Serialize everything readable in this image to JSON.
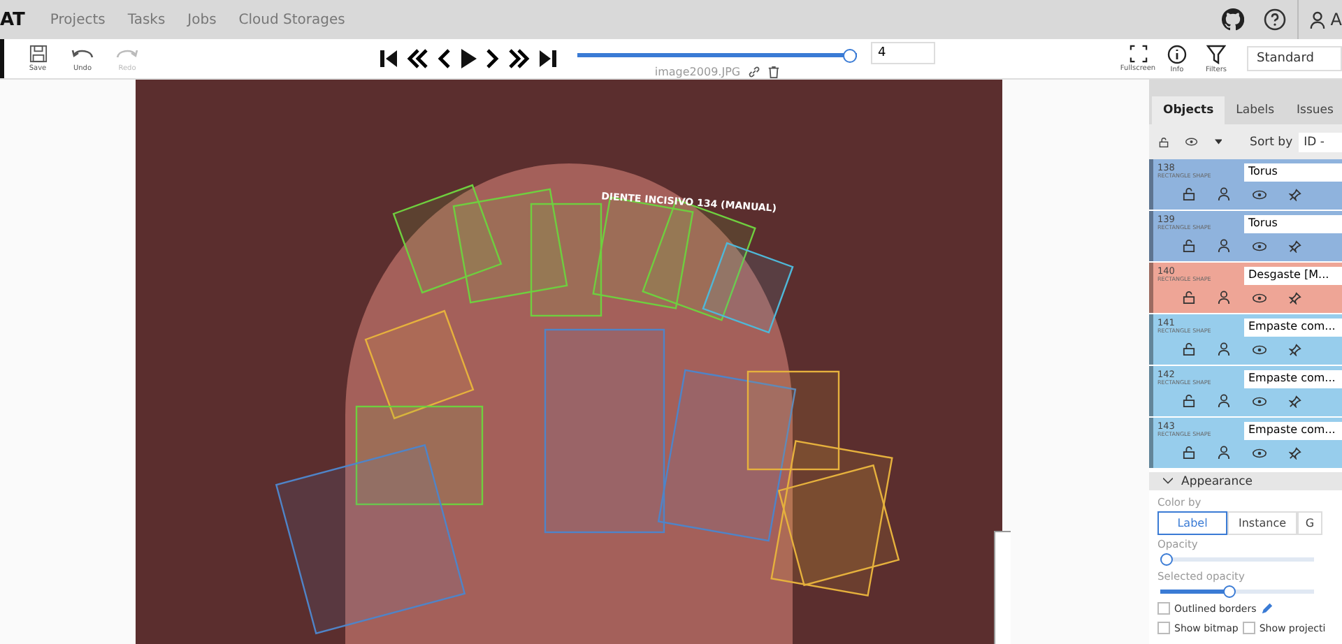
{
  "header": {
    "logo": "AT",
    "menu": [
      "Projects",
      "Tasks",
      "Jobs",
      "Cloud Storages"
    ],
    "user_initial": "A"
  },
  "toolbar": {
    "actions": [
      {
        "label": "Save",
        "kind": "save",
        "disabled": false
      },
      {
        "label": "Undo",
        "kind": "undo",
        "disabled": false
      },
      {
        "label": "Redo",
        "kind": "redo",
        "disabled": true
      }
    ],
    "player": {
      "level": 1.0,
      "frame": "4",
      "filename": "image2009.JPG"
    },
    "view_actions": [
      {
        "label": "Fullscreen",
        "kind": "fullscreen"
      },
      {
        "label": "Info",
        "kind": "info"
      },
      {
        "label": "Filters",
        "kind": "filters"
      }
    ],
    "workspace": "Standard"
  },
  "canvas": {
    "annotation_label": "DIENTE INCISIVO 134 (MANUAL)"
  },
  "sidebar": {
    "tabs": [
      {
        "label": "Objects",
        "selected": true
      },
      {
        "label": "Labels",
        "selected": false
      },
      {
        "label": "Issues",
        "selected": false
      }
    ],
    "sort_label": "Sort by",
    "sort_value": "ID -",
    "objects": [
      {
        "id": "138",
        "type": "RECTANGLE SHAPE",
        "label": "Torus",
        "color": "#8fb3dd"
      },
      {
        "id": "139",
        "type": "RECTANGLE SHAPE",
        "label": "Torus",
        "color": "#8fb3dd"
      },
      {
        "id": "140",
        "type": "RECTANGLE SHAPE",
        "label": "Desgaste [M...",
        "color": "#eea596"
      },
      {
        "id": "141",
        "type": "RECTANGLE SHAPE",
        "label": "Empaste com...",
        "color": "#97cdec"
      },
      {
        "id": "142",
        "type": "RECTANGLE SHAPE",
        "label": "Empaste com...",
        "color": "#97cdec"
      },
      {
        "id": "143",
        "type": "RECTANGLE SHAPE",
        "label": "Empaste com...",
        "color": "#97cdec"
      }
    ],
    "appearance": {
      "title": "Appearance",
      "color_by_label": "Color by",
      "color_by": [
        {
          "label": "Label",
          "selected": true
        },
        {
          "label": "Instance",
          "selected": false
        },
        {
          "label": "G",
          "selected": false
        }
      ],
      "sliders": [
        {
          "label": "Opacity",
          "level": 0.0
        },
        {
          "label": "Selected opacity",
          "level": 0.45
        }
      ],
      "checks": [
        {
          "label": "Outlined borders",
          "checked": false,
          "pencil": true
        },
        {
          "label": "Show bitmap",
          "checked": false,
          "pencil": false
        },
        {
          "label": "Show projecti",
          "checked": false,
          "pencil": false
        }
      ]
    }
  }
}
